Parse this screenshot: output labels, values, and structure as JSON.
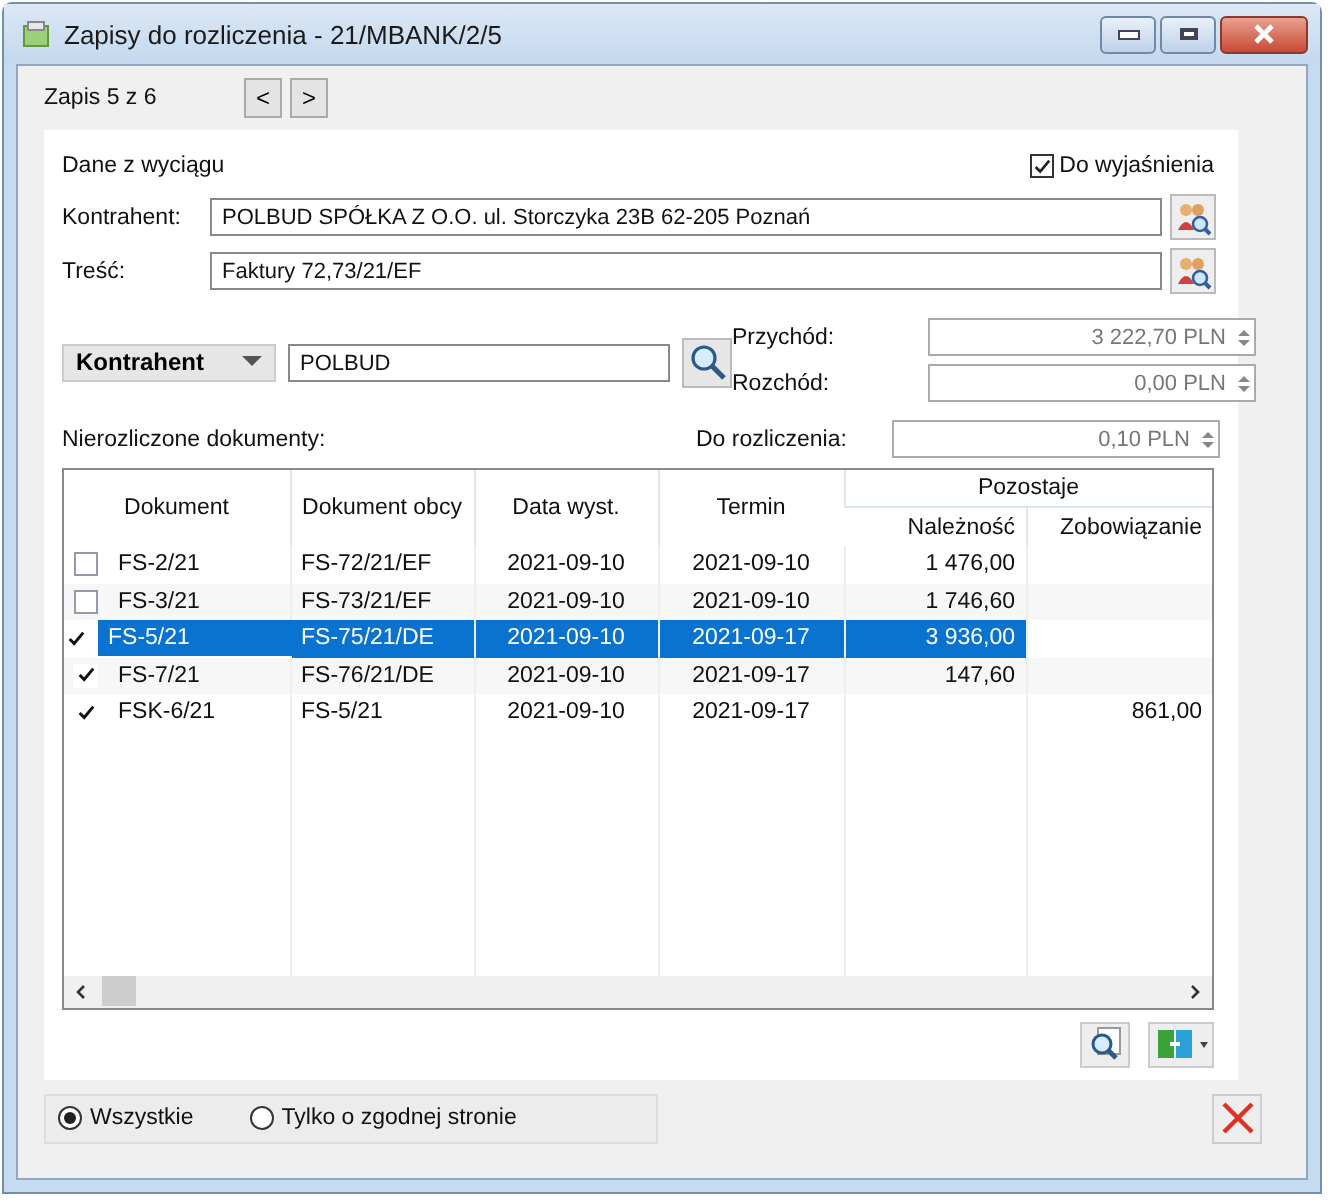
{
  "window": {
    "title": "Zapisy do rozliczenia - 21/MBANK/2/5"
  },
  "record_nav": {
    "label": "Zapis 5 z 6",
    "prev": "<",
    "next": ">"
  },
  "statement": {
    "heading": "Dane z wyciągu",
    "needs_explanation": {
      "label": "Do wyjaśnienia",
      "checked": true
    }
  },
  "fields": [
    {
      "label": "Kontrahent:",
      "value": "POLBUD SPÓŁKA Z O.O. ul. Storczyka 23B 62-205 Poznań"
    },
    {
      "label": "Treść:",
      "value": "Faktury 72,73/21/EF"
    }
  ],
  "filter": {
    "selector": "Kontrahent",
    "value": "POLBUD"
  },
  "amounts": [
    {
      "label": "Przychód:",
      "value": "3 222,70 PLN",
      "disabled": true
    },
    {
      "label": "Rozchód:",
      "value": "0,00 PLN",
      "disabled": true
    },
    {
      "label": "Do rozliczenia:",
      "value": "0,10 PLN",
      "disabled": true
    }
  ],
  "documents_label": "Nierozliczone dokumenty:",
  "table": {
    "columns": [
      "Dokument",
      "Dokument obcy",
      "Data wyst.",
      "Termin"
    ],
    "group": {
      "label": "Pozostaje",
      "columns": [
        "Należność",
        "Zobowiązanie"
      ]
    },
    "rows": [
      {
        "checked": false,
        "selected": false,
        "cells": [
          "FS-2/21",
          "FS-72/21/EF",
          "2021-09-10",
          "2021-09-10",
          "1 476,00",
          ""
        ]
      },
      {
        "checked": false,
        "selected": false,
        "cells": [
          "FS-3/21",
          "FS-73/21/EF",
          "2021-09-10",
          "2021-09-10",
          "1 746,60",
          ""
        ]
      },
      {
        "checked": true,
        "selected": true,
        "cells": [
          "FS-5/21",
          "FS-75/21/DE",
          "2021-09-10",
          "2021-09-17",
          "3 936,00",
          ""
        ]
      },
      {
        "checked": true,
        "selected": false,
        "cells": [
          "FS-7/21",
          "FS-76/21/DE",
          "2021-09-10",
          "2021-09-17",
          "147,60",
          ""
        ]
      },
      {
        "checked": true,
        "selected": false,
        "cells": [
          "FSK-6/21",
          "FS-5/21",
          "2021-09-10",
          "2021-09-17",
          "",
          "861,00"
        ]
      }
    ]
  },
  "scope": [
    {
      "label": "Wszystkie",
      "selected": true
    },
    {
      "label": "Tylko o zgodnej stronie",
      "selected": false
    }
  ]
}
